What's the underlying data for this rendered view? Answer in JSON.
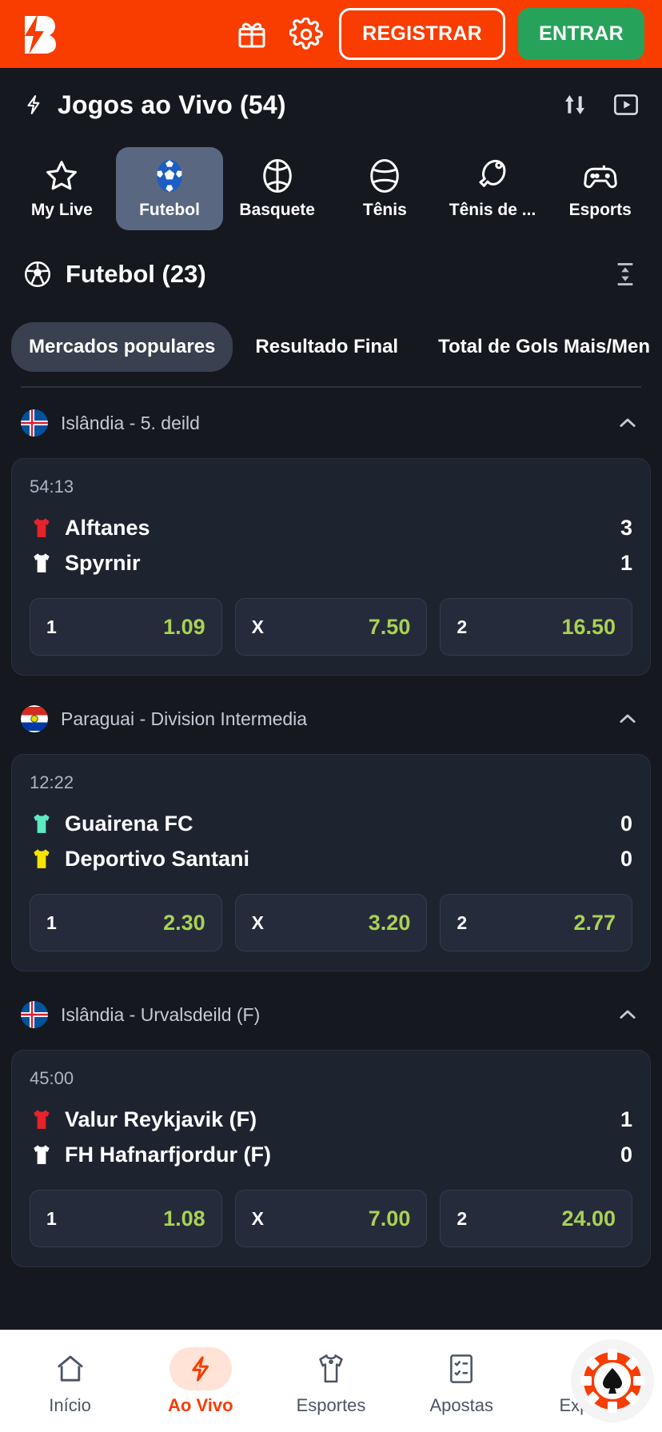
{
  "header": {
    "logo_icon": "brand-b-bolt-logo",
    "gift_icon": "gift-icon",
    "settings_icon": "gear-icon",
    "register_label": "REGISTRAR",
    "login_label": "ENTRAR",
    "brand_color": "#f93c00",
    "login_color": "#27a25b"
  },
  "live": {
    "bolt_icon": "lightning-icon",
    "title": "Jogos ao Vivo (54)",
    "sort_icon": "sort-arrows-icon",
    "stream_icon": "video-stream-icon"
  },
  "sport_tabs": [
    {
      "label": "My Live",
      "icon": "star-icon",
      "active": false
    },
    {
      "label": "Futebol",
      "icon": "soccer-ball-icon",
      "active": true
    },
    {
      "label": "Basquete",
      "icon": "basketball-icon",
      "active": false
    },
    {
      "label": "Tênis",
      "icon": "tennis-ball-icon",
      "active": false
    },
    {
      "label": "Tênis de ...",
      "icon": "table-tennis-icon",
      "active": false
    },
    {
      "label": "Esports",
      "icon": "gamepad-icon",
      "active": false
    }
  ],
  "section": {
    "icon": "soccer-ball-icon",
    "title": "Futebol (23)",
    "collapse_icon": "collapse-all-icon"
  },
  "market_tabs": [
    {
      "label": "Mercados populares",
      "active": true
    },
    {
      "label": "Resultado Final",
      "active": false
    },
    {
      "label": "Total de Gols Mais/Men",
      "active": false
    }
  ],
  "leagues": [
    {
      "flag": "iceland-flag-icon",
      "name": "Islândia - 5. deild",
      "chevron": "chevron-up-icon",
      "matches": [
        {
          "time": "54:13",
          "home": {
            "name": "Alftanes",
            "score": "3",
            "jersey_color": "#e8222a"
          },
          "away": {
            "name": "Spyrnir",
            "score": "1",
            "jersey_color": "#ffffff"
          },
          "odds": [
            {
              "label": "1",
              "value": "1.09"
            },
            {
              "label": "X",
              "value": "7.50"
            },
            {
              "label": "2",
              "value": "16.50"
            }
          ]
        }
      ]
    },
    {
      "flag": "paraguay-flag-icon",
      "name": "Paraguai - Division Intermedia",
      "chevron": "chevron-up-icon",
      "matches": [
        {
          "time": "12:22",
          "home": {
            "name": "Guairena FC",
            "score": "0",
            "jersey_color": "#5eeac0"
          },
          "away": {
            "name": "Deportivo Santani",
            "score": "0",
            "jersey_color": "#f5e400"
          },
          "odds": [
            {
              "label": "1",
              "value": "2.30"
            },
            {
              "label": "X",
              "value": "3.20"
            },
            {
              "label": "2",
              "value": "2.77"
            }
          ]
        }
      ]
    },
    {
      "flag": "iceland-flag-icon",
      "name": "Islândia - Urvalsdeild (F)",
      "chevron": "chevron-up-icon",
      "matches": [
        {
          "time": "45:00",
          "home": {
            "name": "Valur Reykjavik (F)",
            "score": "1",
            "jersey_color": "#e8222a"
          },
          "away": {
            "name": "FH Hafnarfjordur (F)",
            "score": "0",
            "jersey_color": "#ffffff"
          },
          "odds": [
            {
              "label": "1",
              "value": "1.08"
            },
            {
              "label": "X",
              "value": "7.00"
            },
            {
              "label": "2",
              "value": "24.00"
            }
          ]
        }
      ]
    }
  ],
  "bottom_nav": [
    {
      "label": "Início",
      "icon": "home-icon",
      "active": false
    },
    {
      "label": "Ao Vivo",
      "icon": "lightning-icon",
      "active": true
    },
    {
      "label": "Esportes",
      "icon": "jersey-icon",
      "active": false
    },
    {
      "label": "Apostas",
      "icon": "bet-slip-icon",
      "active": false
    },
    {
      "label": "Explorar",
      "icon": "search-icon",
      "active": false
    }
  ],
  "fab": {
    "icon": "casino-chip-icon"
  },
  "colors": {
    "odds_green": "#a9d155",
    "active_tab_bg": "#5a6781",
    "card_bg": "#1e2330"
  }
}
